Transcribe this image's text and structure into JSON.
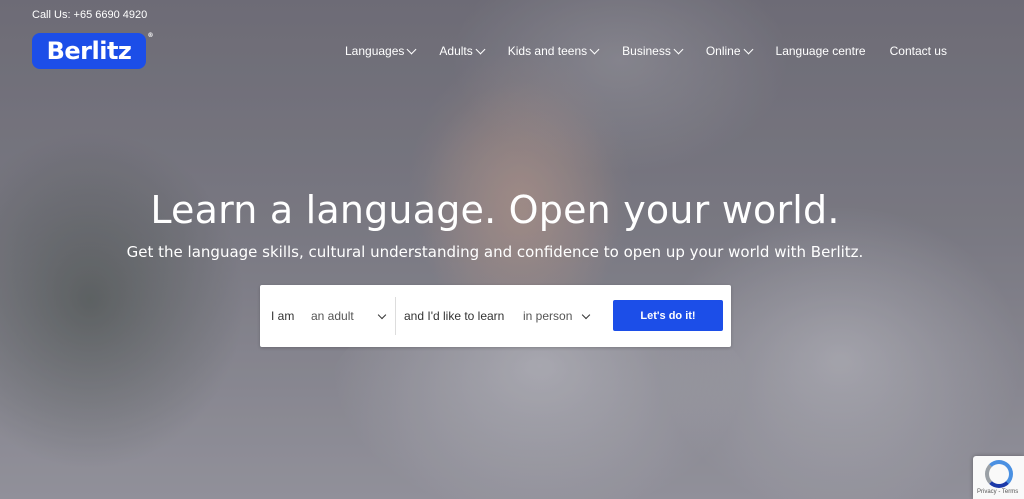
{
  "topbar": {
    "phone": "Call Us: +65 6690 4920"
  },
  "logo": {
    "text": "Berlitz",
    "mark": "®",
    "color": "#1c4ee8"
  },
  "nav": {
    "items": [
      {
        "label": "Languages",
        "has_dropdown": true
      },
      {
        "label": "Adults",
        "has_dropdown": true
      },
      {
        "label": "Kids and teens",
        "has_dropdown": true
      },
      {
        "label": "Business",
        "has_dropdown": true
      },
      {
        "label": "Online",
        "has_dropdown": true
      },
      {
        "label": "Language centre",
        "has_dropdown": false
      },
      {
        "label": "Contact us",
        "has_dropdown": false
      }
    ]
  },
  "hero": {
    "title": "Learn a language. Open your world.",
    "subtitle": "Get the language skills, cultural understanding and confidence to open up your world with Berlitz."
  },
  "form": {
    "label_i_am": "I am",
    "audience_value": "an adult",
    "label_learn": "and I'd like to learn",
    "mode_value": "in person",
    "submit_label": "Let's do it!",
    "accent_color": "#1c4ee8"
  },
  "recaptcha": {
    "links": "Privacy - Terms",
    "icon": "recaptcha-icon"
  }
}
